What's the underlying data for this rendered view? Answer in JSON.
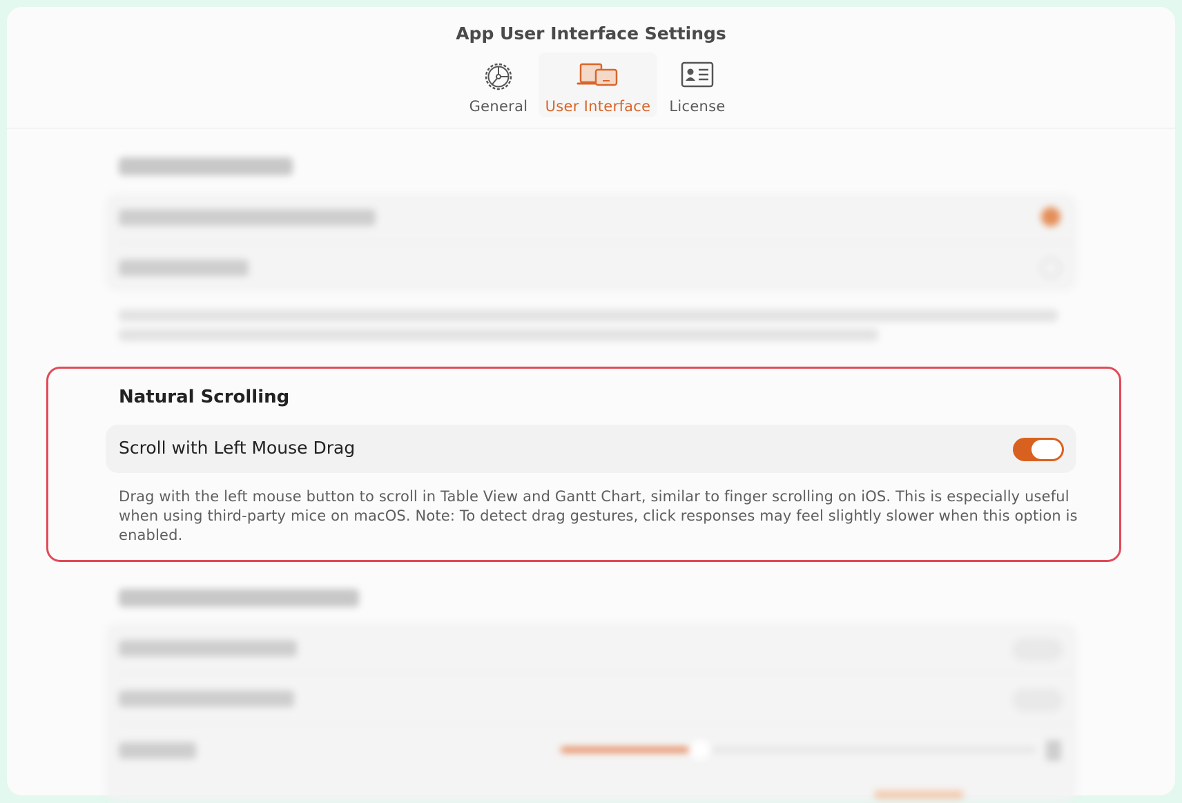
{
  "window": {
    "title": "App User Interface Settings"
  },
  "tabs": [
    {
      "label": "General",
      "icon": "gear-icon",
      "active": false
    },
    {
      "label": "User Interface",
      "icon": "devices-icon",
      "active": true
    },
    {
      "label": "License",
      "icon": "id-card-icon",
      "active": false
    }
  ],
  "colors": {
    "accent": "#d9611f",
    "highlight_border": "#e24a57",
    "tab_active_text": "#d8662a"
  },
  "natural_scrolling": {
    "title": "Natural Scrolling",
    "option_label": "Scroll with Left Mouse Drag",
    "enabled": true,
    "description": "Drag with the left mouse button to scroll in Table View and Gantt Chart, similar to finger scrolling on iOS. This is especially useful when using third-party mice on macOS. Note: To detect drag gestures, click responses may feel slightly slower when this option is enabled."
  }
}
